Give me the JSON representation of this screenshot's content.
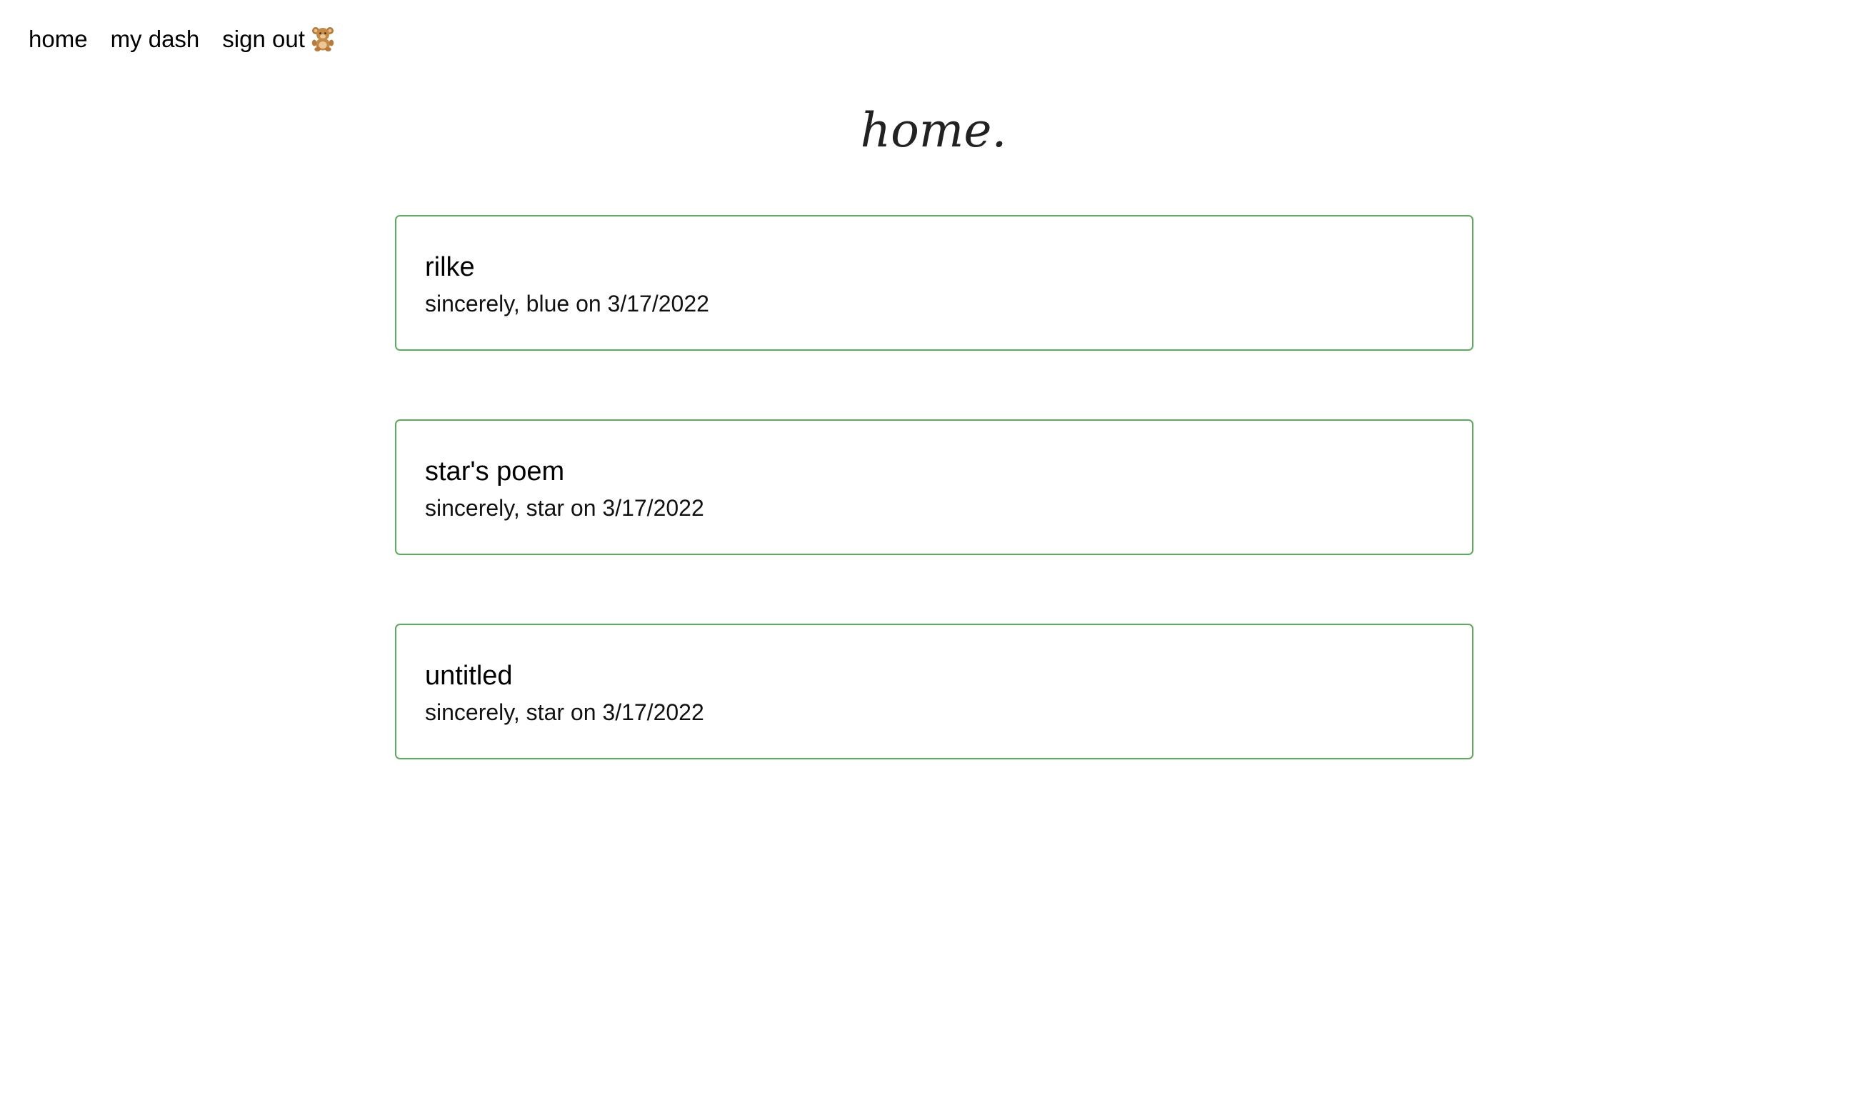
{
  "nav": {
    "items": [
      {
        "label": "home"
      },
      {
        "label": "my dash"
      },
      {
        "label": "sign out",
        "icon": "teddy-bear-icon"
      }
    ]
  },
  "page": {
    "title": "home."
  },
  "posts": [
    {
      "title": "rilke",
      "byline": "sincerely, blue on 3/17/2022"
    },
    {
      "title": "star's poem",
      "byline": "sincerely, star on 3/17/2022"
    },
    {
      "title": "untitled",
      "byline": "sincerely, star on 3/17/2022"
    }
  ],
  "colors": {
    "card_border": "#5cab5c",
    "title": "#222222",
    "text": "#000000"
  }
}
